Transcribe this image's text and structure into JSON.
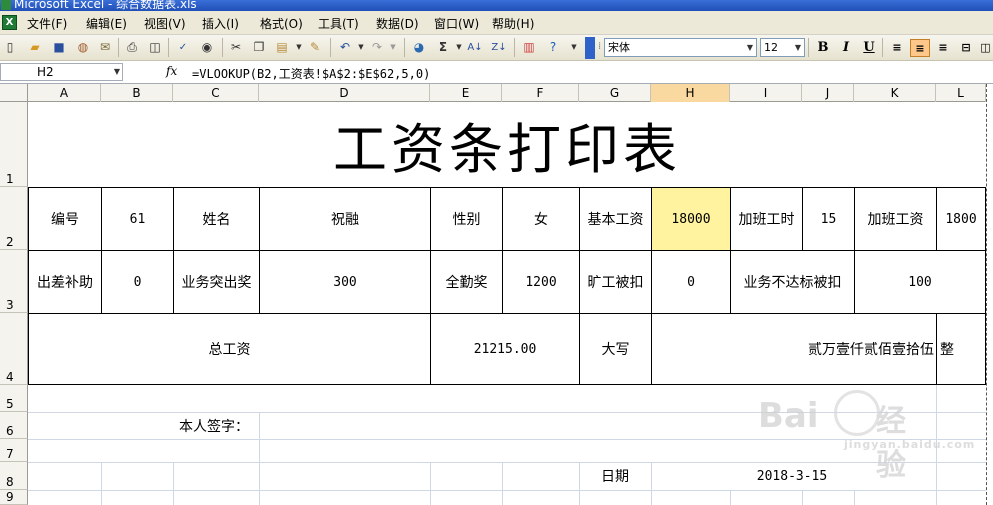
{
  "app": {
    "title": "Microsoft Excel - 综合数据表.xls",
    "icon": "excel-icon"
  },
  "menu": {
    "items": [
      "文件(F)",
      "编辑(E)",
      "视图(V)",
      "插入(I)",
      "格式(O)",
      "工具(T)",
      "数据(D)",
      "窗口(W)",
      "帮助(H)"
    ]
  },
  "toolbar": {
    "font_name": "宋体",
    "font_size": "12",
    "bold": "B",
    "italic": "I",
    "underline": "U",
    "sigma": "Σ",
    "icons": [
      "new-icon",
      "open-icon",
      "save-icon",
      "permission-icon",
      "email-icon",
      "print-icon",
      "print-preview-icon",
      "spelling-icon",
      "research-icon",
      "cut-icon",
      "copy-icon",
      "paste-icon",
      "format-painter-icon",
      "undo-icon",
      "redo-icon",
      "hyperlink-icon",
      "autosum-icon",
      "sort-asc-icon",
      "sort-desc-icon",
      "chart-wizard-icon",
      "help-icon"
    ],
    "align_active": "center"
  },
  "formula_bar": {
    "name_box": "H2",
    "fx": "fx",
    "formula": "=VLOOKUP(B2,工资表!$A$2:$E$62,5,0)"
  },
  "columns": [
    "A",
    "B",
    "C",
    "D",
    "E",
    "F",
    "G",
    "H",
    "I",
    "J",
    "K",
    "L"
  ],
  "selected_column": "H",
  "rows": [
    "1",
    "2",
    "3",
    "4",
    "5",
    "6",
    "7",
    "8",
    "9"
  ],
  "sheet": {
    "title": "工资条打印表",
    "r2": {
      "A": "编号",
      "B": "61",
      "C": "姓名",
      "D": "祝融",
      "E": "性别",
      "F": "女",
      "G": "基本工资",
      "H": "18000",
      "I": "加班工时",
      "J": "15",
      "K": "加班工资",
      "L": "1800"
    },
    "r3": {
      "A": "出差补助",
      "B": "0",
      "C": "业务突出奖",
      "D": "300",
      "E": "全勤奖",
      "F": "1200",
      "G": "旷工被扣",
      "H": "0",
      "I": "业务不达标被扣",
      "K": "100"
    },
    "r4": {
      "total_label": "总工资",
      "total_value": "21215.00",
      "daxie_label": "大写",
      "daxie_value": "贰万壹仟贰佰壹拾伍",
      "zheng": "整"
    },
    "r6": {
      "signature_label": "本人签字："
    },
    "r8": {
      "date_label": "日期",
      "date_value": "2018-3-15"
    }
  },
  "colors": {
    "selected_cell": "#fff3a0",
    "grid": "#d0d7e5",
    "border": "#000000",
    "active_button": "#ffc88a"
  },
  "watermark": {
    "text1": "Bai",
    "text2": "经验",
    "text3": "jingyan.baidu.com"
  }
}
